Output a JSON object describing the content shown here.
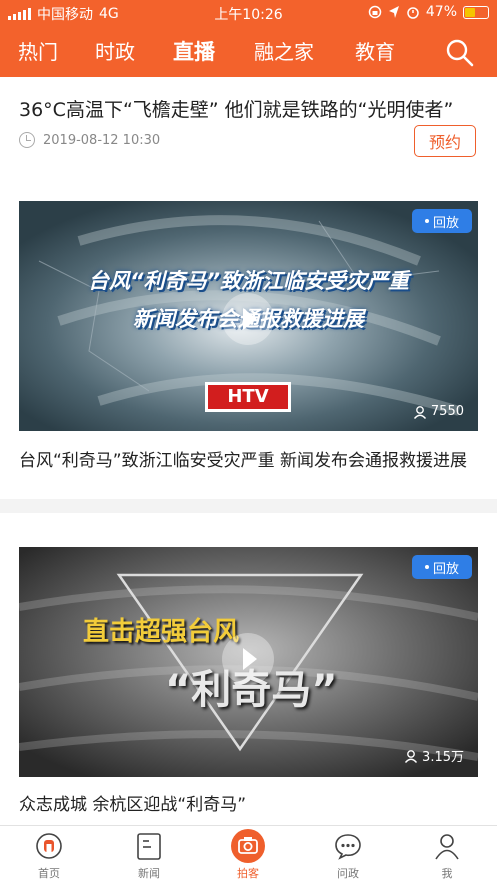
{
  "status_bar": {
    "carrier": "中国移动",
    "network": "4G",
    "time": "上午10:26",
    "battery": "47%",
    "battery_level": 0.47
  },
  "nav": {
    "tabs": [
      "热门",
      "时政",
      "直播",
      "融之家",
      "教育"
    ],
    "active_tab": "直播",
    "accent": "#f3622c"
  },
  "items": [
    {
      "title": "36°C高温下“飞檐走壁” 他们就是铁路的“光明使者”",
      "datetime": "2019-08-12 10:30",
      "button": "预约"
    },
    {
      "badge": "回放",
      "views": "7550",
      "overlay_line1": "台风“利奇马”致浙江临安受灾严重",
      "overlay_line2": "新闻发布会通报救援进展",
      "logo": "HTV",
      "caption": "台风“利奇马”致浙江临安受灾严重  新闻发布会通报救援进展"
    },
    {
      "badge": "回放",
      "views": "3.15万",
      "overlay_line1": "直击超强台风",
      "overlay_line2": "“利奇马”",
      "caption": "众志成城 余杭区迎战“利奇马”"
    }
  ],
  "bottom_nav": {
    "items": [
      "首页",
      "新闻",
      "拍客",
      "问政",
      "我"
    ],
    "active": "拍客"
  }
}
